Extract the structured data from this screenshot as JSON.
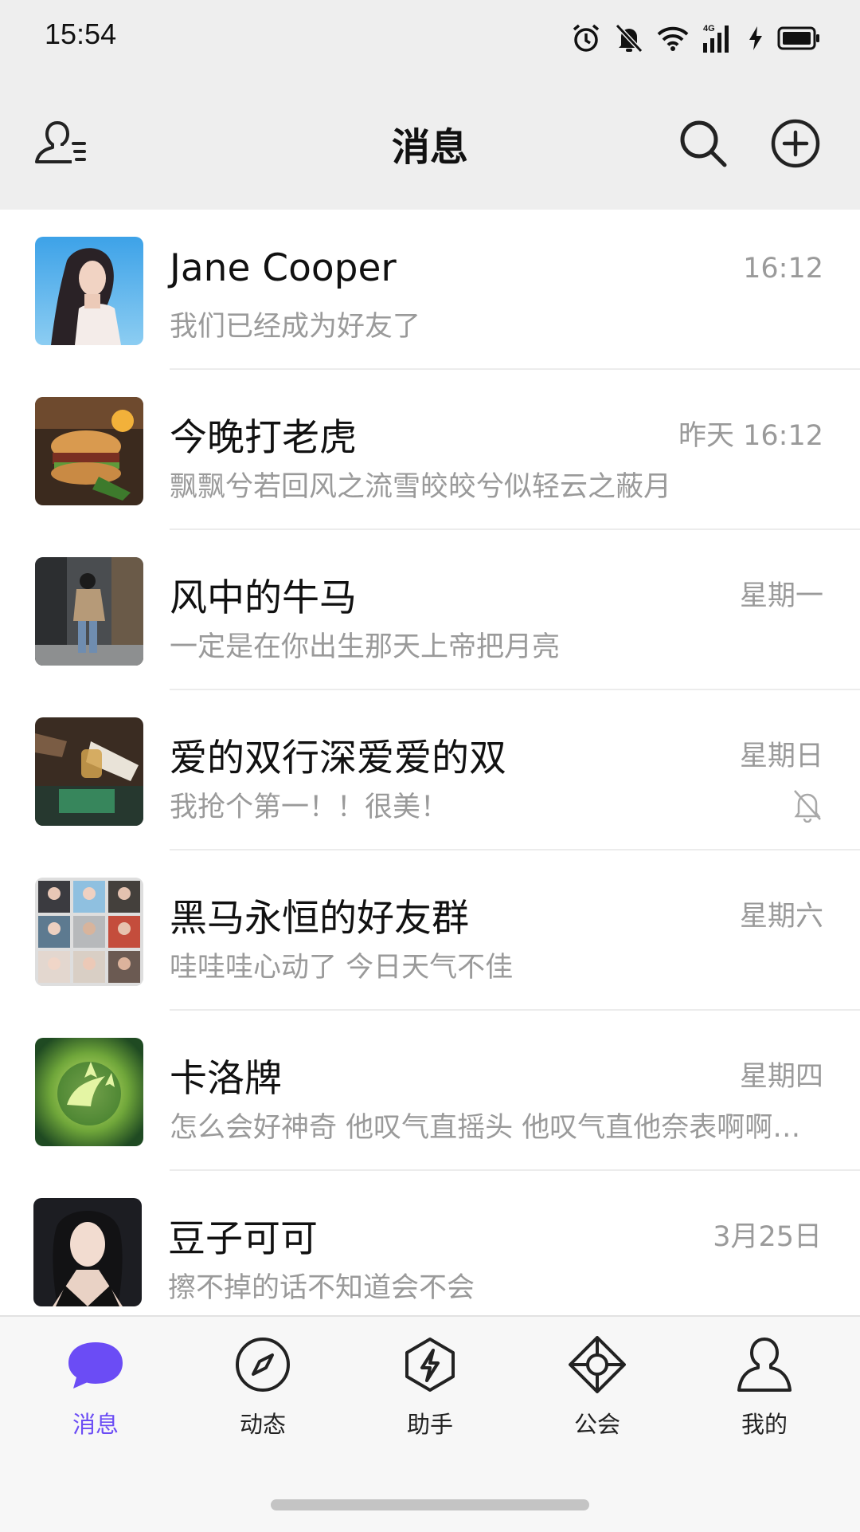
{
  "status_bar": {
    "time": "15:54",
    "icons": [
      "alarm-icon",
      "mute-bell-icon",
      "wifi-icon",
      "4g-signal-icon",
      "charging-icon",
      "battery-icon"
    ],
    "network_label": "4G"
  },
  "header": {
    "title": "消息",
    "left_icon": "contacts-icon",
    "right_icons": [
      "search-icon",
      "add-circle-icon"
    ]
  },
  "chats": [
    {
      "name": "Jane Cooper",
      "time": "16:12",
      "message": "我们已经成为好友了",
      "muted": false
    },
    {
      "name": "今晚打老虎",
      "time": "昨天 16:12",
      "message": "飘飘兮若回风之流雪皎皎兮似轻云之蔽月",
      "muted": false
    },
    {
      "name": "风中的牛马",
      "time": "星期一",
      "message": "一定是在你出生那天上帝把月亮",
      "muted": false
    },
    {
      "name": "爱的双行深爱爱的双",
      "time": "星期日",
      "message": "我抢个第一！！很美！",
      "muted": true
    },
    {
      "name": "黑马永恒的好友群",
      "time": "星期六",
      "message": "哇哇哇心动了 今日天气不佳",
      "muted": false
    },
    {
      "name": "卡洛牌",
      "time": "星期四",
      "message": "怎么会好神奇 他叹气直摇头 他叹气直他奈表啊啊啊啊啊",
      "muted": false
    },
    {
      "name": "豆子可可",
      "time": "3月25日",
      "message": "擦不掉的话不知道会不会",
      "muted": false
    }
  ],
  "bottom_nav": [
    {
      "label": "消息",
      "icon": "message-bubble-icon",
      "active": true
    },
    {
      "label": "动态",
      "icon": "compass-icon",
      "active": false
    },
    {
      "label": "助手",
      "icon": "lightning-hexagon-icon",
      "active": false
    },
    {
      "label": "公会",
      "icon": "guild-icon",
      "active": false
    },
    {
      "label": "我的",
      "icon": "profile-icon",
      "active": false
    }
  ],
  "colors": {
    "accent": "#6b4cf5",
    "background": "#eeeeee",
    "secondary_text": "#9a9a9a"
  }
}
